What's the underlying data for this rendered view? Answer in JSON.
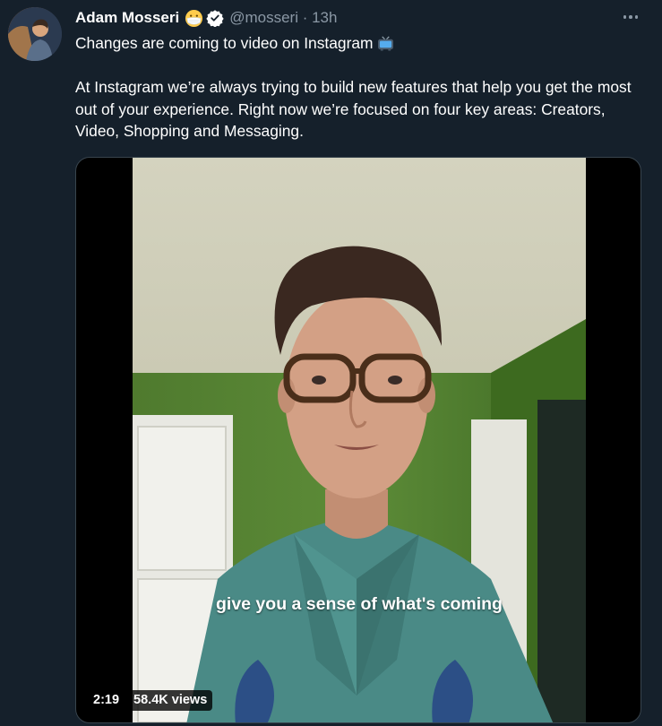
{
  "tweet": {
    "author_name": "Adam Mosseri",
    "author_emoji": "face-with-medical-mask",
    "verified": true,
    "handle_time": "@mosseri · 13h",
    "line1": "Changes are coming to video on Instagram",
    "line1_emoji": "television",
    "body": "At Instagram we’re always trying to build new features that help you get the most out of your experience. Right now we’re focused on four key areas: Creators, Video, Shopping and Messaging."
  },
  "video": {
    "caption": "give you a sense of what's coming",
    "duration": "2:19",
    "views": "58.4K views"
  },
  "colors": {
    "background": "#15202b",
    "secondary_text": "#8b98a5",
    "border": "#38444d",
    "verified_badge": "#ffffff"
  },
  "icons": {
    "more": "more-horizontal-icon",
    "verified": "verified-badge-icon"
  }
}
